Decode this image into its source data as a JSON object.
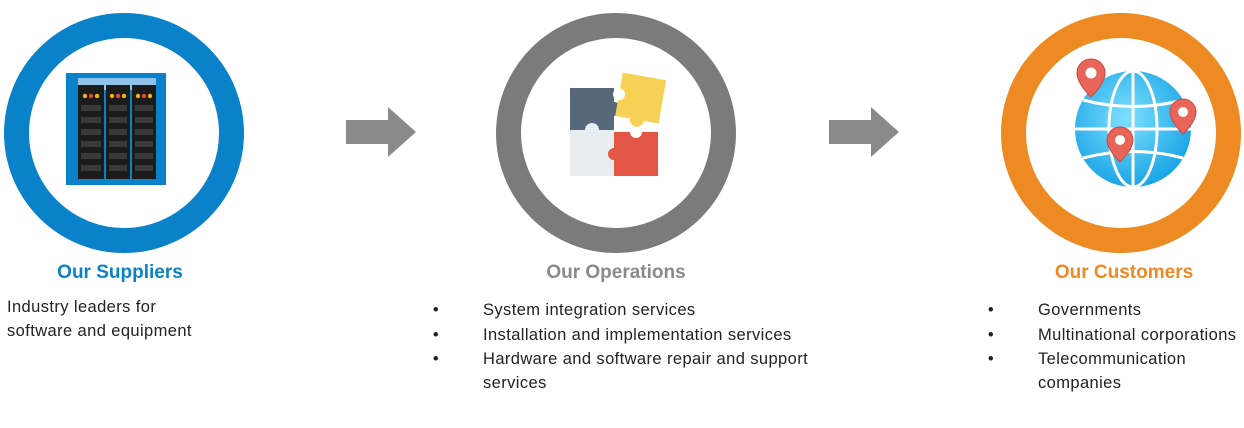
{
  "colors": {
    "suppliers": "#0a82c9",
    "operations": "#7b7b7b",
    "customers": "#ee8a22",
    "arrow": "#8a8a8a"
  },
  "icons": {
    "suppliers": "server-rack-icon",
    "operations": "puzzle-icon",
    "customers": "globe-pins-icon",
    "arrow": "right-arrow-icon"
  },
  "suppliers": {
    "title": "Our Suppliers",
    "text": "Industry leaders for software and equipment"
  },
  "operations": {
    "title": "Our Operations",
    "items": [
      "System integration services",
      "Installation and implementation services",
      "Hardware and software repair and support services"
    ]
  },
  "customers": {
    "title": "Our Customers",
    "items": [
      "Governments",
      "Multinational corporations",
      "Telecommunication companies"
    ]
  }
}
